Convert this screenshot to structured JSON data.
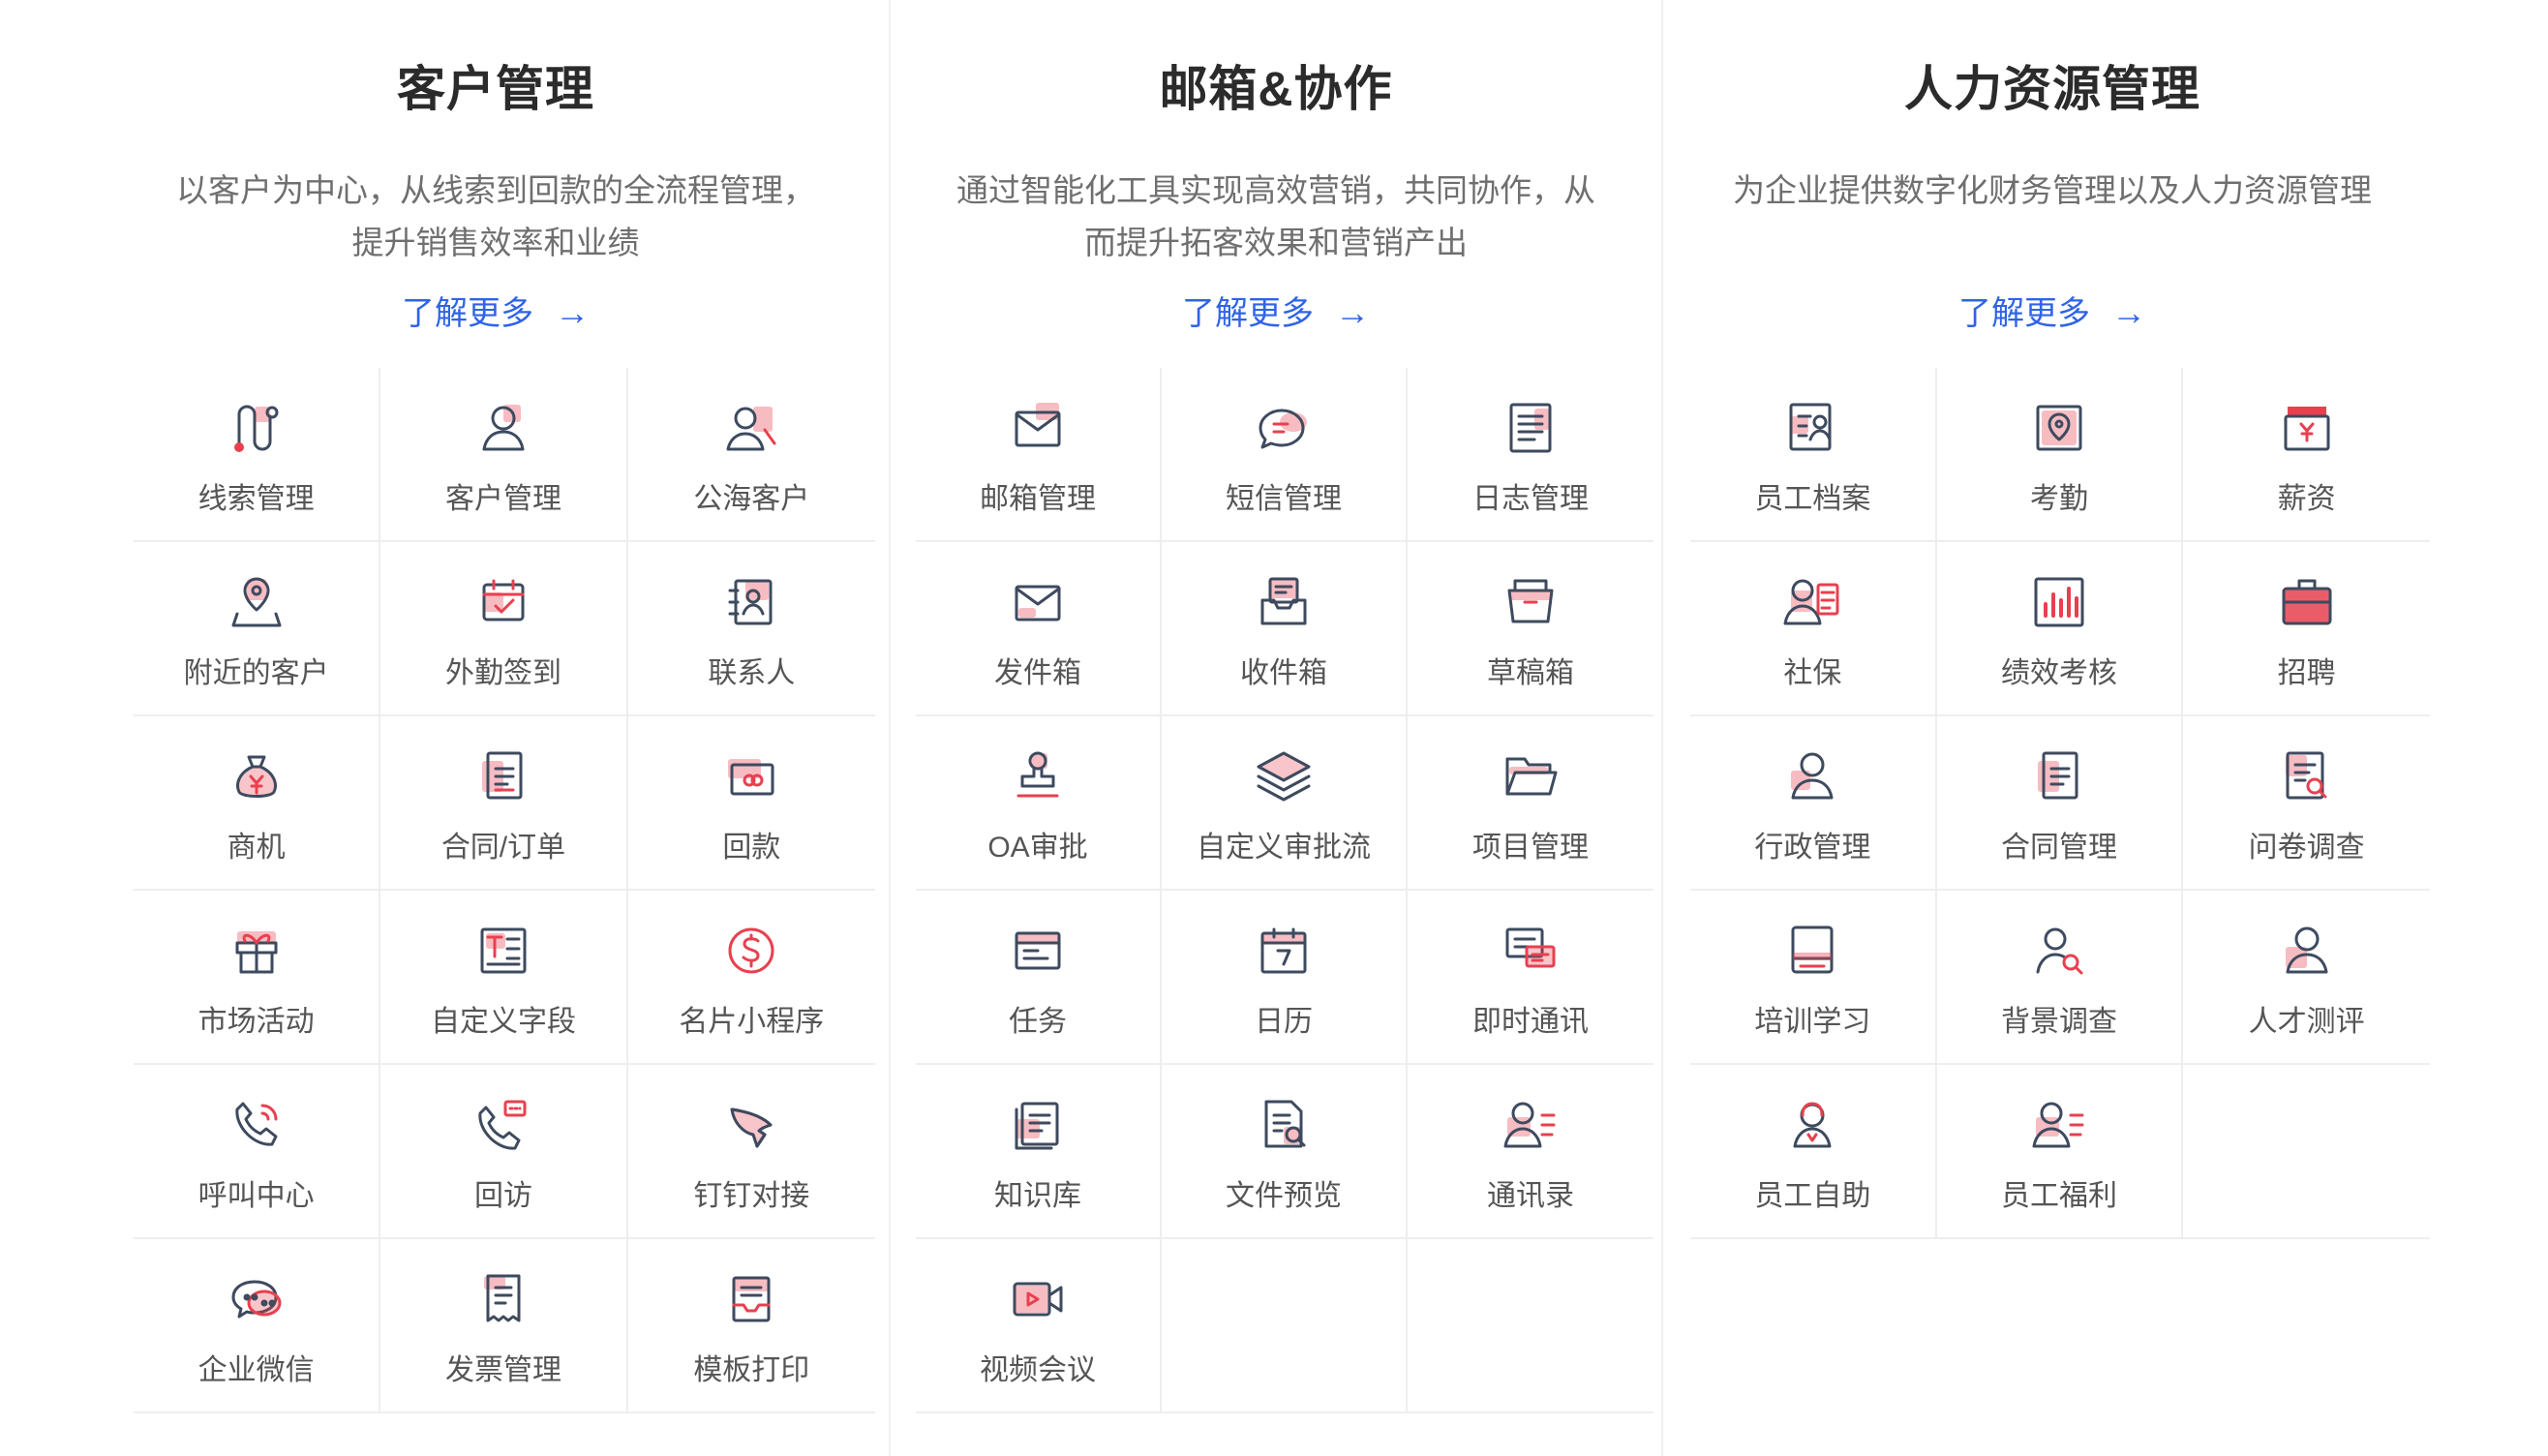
{
  "colors": {
    "accent": "#e8404f",
    "outline": "#3e4a5e",
    "link": "#2f63e8",
    "title": "#2b2b2b",
    "text": "#555555"
  },
  "columns": [
    {
      "title": "客户管理",
      "desc_lines": [
        "以客户为中心，从线索到回款的全流程管理，",
        "提升销售效率和业绩"
      ],
      "learn_more": "了解更多",
      "arrow": "→",
      "items": [
        {
          "label": "线索管理",
          "icon": "lead-icon"
        },
        {
          "label": "客户管理",
          "icon": "customer-icon"
        },
        {
          "label": "公海客户",
          "icon": "public-customers-icon"
        },
        {
          "label": "附近的客户",
          "icon": "nearby-location-icon"
        },
        {
          "label": "外勤签到",
          "icon": "field-checkin-icon"
        },
        {
          "label": "联系人",
          "icon": "contacts-book-icon"
        },
        {
          "label": "商机",
          "icon": "money-bag-icon"
        },
        {
          "label": "合同/订单",
          "icon": "contract-icon"
        },
        {
          "label": "回款",
          "icon": "payment-card-icon"
        },
        {
          "label": "市场活动",
          "icon": "gift-icon"
        },
        {
          "label": "自定义字段",
          "icon": "custom-field-icon"
        },
        {
          "label": "名片小程序",
          "icon": "dollar-circle-icon"
        },
        {
          "label": "呼叫中心",
          "icon": "phone-icon"
        },
        {
          "label": "回访",
          "icon": "phone-message-icon"
        },
        {
          "label": "钉钉对接",
          "icon": "dingtalk-icon"
        },
        {
          "label": "企业微信",
          "icon": "chat-bubbles-icon"
        },
        {
          "label": "发票管理",
          "icon": "invoice-icon"
        },
        {
          "label": "模板打印",
          "icon": "print-template-icon"
        }
      ]
    },
    {
      "title": "邮箱&协作",
      "desc_lines": [
        "通过智能化工具实现高效营销，共同协作，从",
        "而提升拓客效果和营销产出"
      ],
      "learn_more": "了解更多",
      "arrow": "→",
      "items": [
        {
          "label": "邮箱管理",
          "icon": "mail-icon"
        },
        {
          "label": "短信管理",
          "icon": "sms-icon"
        },
        {
          "label": "日志管理",
          "icon": "log-document-icon"
        },
        {
          "label": "发件箱",
          "icon": "outbox-mail-icon"
        },
        {
          "label": "收件箱",
          "icon": "inbox-tray-icon"
        },
        {
          "label": "草稿箱",
          "icon": "draft-folder-icon"
        },
        {
          "label": "OA审批",
          "icon": "approval-stamp-icon"
        },
        {
          "label": "自定义审批流",
          "icon": "layers-icon"
        },
        {
          "label": "项目管理",
          "icon": "project-folder-icon"
        },
        {
          "label": "任务",
          "icon": "task-window-icon"
        },
        {
          "label": "日历",
          "icon": "calendar-icon"
        },
        {
          "label": "即时通讯",
          "icon": "instant-message-icon"
        },
        {
          "label": "知识库",
          "icon": "knowledge-base-icon"
        },
        {
          "label": "文件预览",
          "icon": "file-preview-icon"
        },
        {
          "label": "通讯录",
          "icon": "address-book-icon"
        },
        {
          "label": "视频会议",
          "icon": "video-camera-icon"
        }
      ]
    },
    {
      "title": "人力资源管理",
      "desc_lines": [
        "为企业提供数字化财务管理以及人力资源管理"
      ],
      "learn_more": "了解更多",
      "arrow": "→",
      "items": [
        {
          "label": "员工档案",
          "icon": "employee-file-icon"
        },
        {
          "label": "考勤",
          "icon": "attendance-location-icon"
        },
        {
          "label": "薪资",
          "icon": "salary-icon"
        },
        {
          "label": "社保",
          "icon": "social-security-icon"
        },
        {
          "label": "绩效考核",
          "icon": "performance-chart-icon"
        },
        {
          "label": "招聘",
          "icon": "recruit-briefcase-icon"
        },
        {
          "label": "行政管理",
          "icon": "admin-person-icon"
        },
        {
          "label": "合同管理",
          "icon": "contract-manage-icon"
        },
        {
          "label": "问卷调查",
          "icon": "survey-icon"
        },
        {
          "label": "培训学习",
          "icon": "training-book-icon"
        },
        {
          "label": "背景调查",
          "icon": "background-check-icon"
        },
        {
          "label": "人才测评",
          "icon": "talent-assessment-icon"
        },
        {
          "label": "员工自助",
          "icon": "employee-self-service-icon"
        },
        {
          "label": "员工福利",
          "icon": "employee-benefits-icon"
        }
      ]
    }
  ]
}
